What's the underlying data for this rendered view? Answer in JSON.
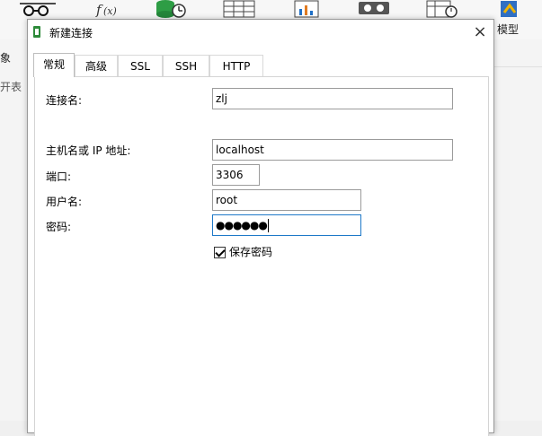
{
  "background": {
    "left_texts": [
      "象",
      "开表"
    ],
    "right_label": "模型"
  },
  "dialog": {
    "title": "新建连接",
    "close_symbol": "×",
    "tabs": [
      {
        "label": "常规",
        "active": true
      },
      {
        "label": "高级",
        "active": false
      },
      {
        "label": "SSL",
        "active": false
      },
      {
        "label": "SSH",
        "active": false
      },
      {
        "label": "HTTP",
        "active": false
      }
    ],
    "general": {
      "connection_name": {
        "label": "连接名:",
        "value": "zlj"
      },
      "host": {
        "label": "主机名或 IP 地址:",
        "value": "localhost"
      },
      "port": {
        "label": "端口:",
        "value": "3306"
      },
      "username": {
        "label": "用户名:",
        "value": "root"
      },
      "password": {
        "label": "密码:",
        "value": "●●●●●●"
      },
      "save_password": {
        "label": "保存密码",
        "checked": true
      }
    }
  },
  "colors": {
    "focus_border": "#1e79c8",
    "dialog_bg": "#ffffff"
  },
  "icons": [
    "glasses-icon",
    "function-icon",
    "database-clock-icon",
    "table-icon",
    "chart-icon",
    "backup-icon",
    "schedule-icon",
    "model-icon",
    "connection-icon",
    "close-icon"
  ]
}
